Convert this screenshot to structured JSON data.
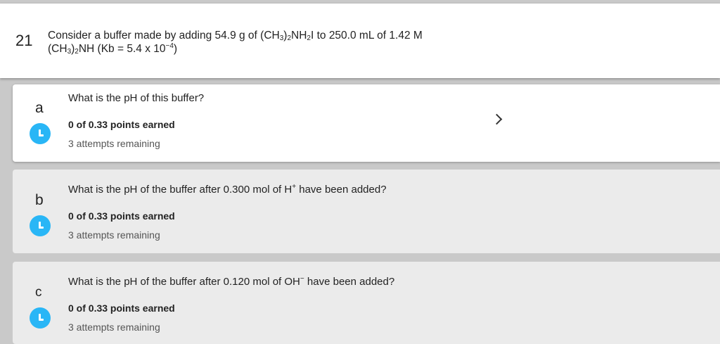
{
  "question": {
    "number": "21",
    "line1": {
      "t1": "Consider a buffer made by adding 54.9 g of (CH",
      "s1": "3",
      "t2": ")",
      "s2": "2",
      "t3": "NH",
      "s3": "2",
      "t4": "I to 250.0 mL of 1.42 M"
    },
    "line2": {
      "t1": "(CH",
      "s1": "3",
      "t2": ")",
      "s2": "2",
      "t3": "NH (Kb = 5.4 x 10",
      "sup": "−4",
      "t4": ")"
    }
  },
  "parts": [
    {
      "letter": "a",
      "prompt": "What is the pH of this buffer?",
      "points": "0 of 0.33 points earned",
      "attempts": "3 attempts remaining",
      "icon": "clock-icon",
      "active": true
    },
    {
      "letter": "b",
      "prompt_before": "What is the pH of the buffer after 0.300 mol of H",
      "prompt_sup": "+",
      "prompt_after": " have been added?",
      "points": "0 of 0.33 points earned",
      "attempts": "3 attempts remaining",
      "icon": "clock-icon"
    },
    {
      "letter": "c",
      "prompt_before": "What is the pH of the buffer after 0.120 mol of OH",
      "prompt_sup": "−",
      "prompt_after": " have been added?",
      "points": "0 of 0.33 points earned",
      "attempts": "3 attempts remaining",
      "icon": "clock-icon"
    }
  ],
  "colors": {
    "accent_clock": "#29b6f6",
    "background": "#c9c9c9",
    "inactive_card": "#ebebeb"
  }
}
